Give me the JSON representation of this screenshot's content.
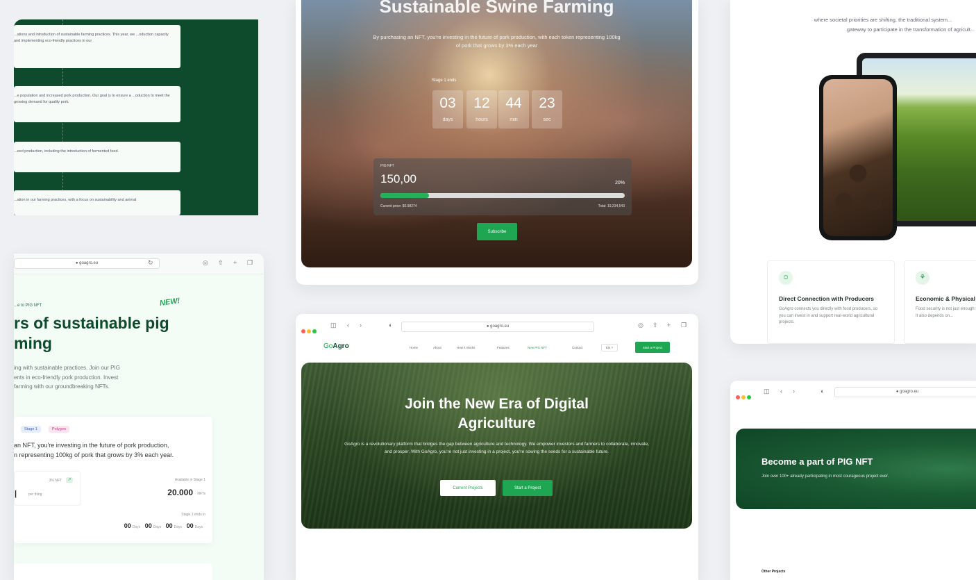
{
  "timeline": {
    "items": [
      "...ations and introduction of sustainable farming practices. This year, we ...oduction capacity and implementing eco-friendly practices in our",
      "...e population and increased pork production. Our goal is to ensure a ...oduction to meet the growing demand for quality pork.",
      "...eed production, including the introduction of fermented feed.",
      "...ation in our farming practices, with a focus on sustainability and animal"
    ]
  },
  "swine": {
    "title": "Sustainable Swine Farming",
    "subtitle": "By purchasing an NFT, you're investing in the future of pork production, with each token representing 100kg of pork that grows by 3% each year",
    "stage_label": "Stage 1 ends",
    "countdown": [
      {
        "value": "03",
        "unit": "days"
      },
      {
        "value": "12",
        "unit": "hours"
      },
      {
        "value": "44",
        "unit": "min"
      },
      {
        "value": "23",
        "unit": "sec"
      }
    ],
    "nft_label": "PIG NFT",
    "price": "150,00",
    "percent": "20%",
    "progress": 0.2,
    "current_price": "Current price: $0.98274",
    "total": "Total: 19,234,543",
    "subscribe_label": "Subscribe"
  },
  "app": {
    "line1": "where societal priorities are shifting, the traditional system...",
    "line2": "gateway to participate in the transformation of agricult...",
    "features": [
      {
        "icon": "users-icon",
        "glyph": "☺",
        "title": "Direct Connection with Producers",
        "desc": "GoAgro connects you directly with food producers, so you can invest in and support real-world agricultural projects."
      },
      {
        "icon": "food-icon",
        "glyph": "⚘",
        "title": "Economic & Physical Food",
        "desc": "Food security is not just enough food at a national level. It also depends on..."
      }
    ]
  },
  "pig": {
    "url": "goagro.eu",
    "kicker": "...e to PIG NFT",
    "new_badge": "NEW!",
    "heading": "...rs of sustainable pig ...ming",
    "heading_line1": "rs of sustainable pig",
    "heading_line2": "ming",
    "desc": "...ing with sustainable practices. Join our PIG ...ents in eco-friendly pork production. Invest ... farming with our groundbreaking NFTs.",
    "desc_lines": [
      "ing with sustainable practices. Join our PIG",
      "ents in eco-friendly pork production. Invest",
      "farming with our groundbreaking NFTs."
    ],
    "tags": [
      "Stage 1",
      "Polygon"
    ],
    "card_text_lines": [
      "an NFT, you're investing in the future of pork production,",
      "n representing 100kg of pork that grows by 3% each year."
    ],
    "nft_small": "3% NFT",
    "per_thing": "per thing",
    "available_label": "Available in Stage 1",
    "available_value": "20.000",
    "available_unit": "NFTs",
    "stage_ends": "Stage 1 ends in",
    "countdown": [
      {
        "value": "00",
        "unit": "Days"
      },
      {
        "value": "00",
        "unit": "Days"
      },
      {
        "value": "00",
        "unit": "Days"
      },
      {
        "value": "00",
        "unit": "Days"
      }
    ]
  },
  "main": {
    "url": "goagro.eu",
    "logo_go": "Go",
    "logo_agro": "Agro",
    "nav": [
      "Home",
      "About",
      "How it Works",
      "Features",
      "New PIG NFT",
      "Contact"
    ],
    "lang": "EN",
    "nav_cta": "Start a Project",
    "title_line1": "Join the New Era of Digital",
    "title_line2": "Agriculture",
    "desc": "GoAgro is a revolutionary platform that bridges the gap between agriculture and technology. We empower investors and farmers to collaborate, innovate, and prosper. With GoAgro, you're not just investing in a project, you're sowing the seeds for a sustainable future.",
    "btn_current": "Current Projects",
    "btn_start": "Start a Project"
  },
  "become": {
    "url": "goagro.eu",
    "title": "Become a part of PIG NFT",
    "subtitle": "Join over 100+ already participating in most courageous project ever.",
    "other_projects": "Other Projects"
  },
  "colors": {
    "brand_green": "#1fa653",
    "dark_green": "#0e4b2c"
  }
}
